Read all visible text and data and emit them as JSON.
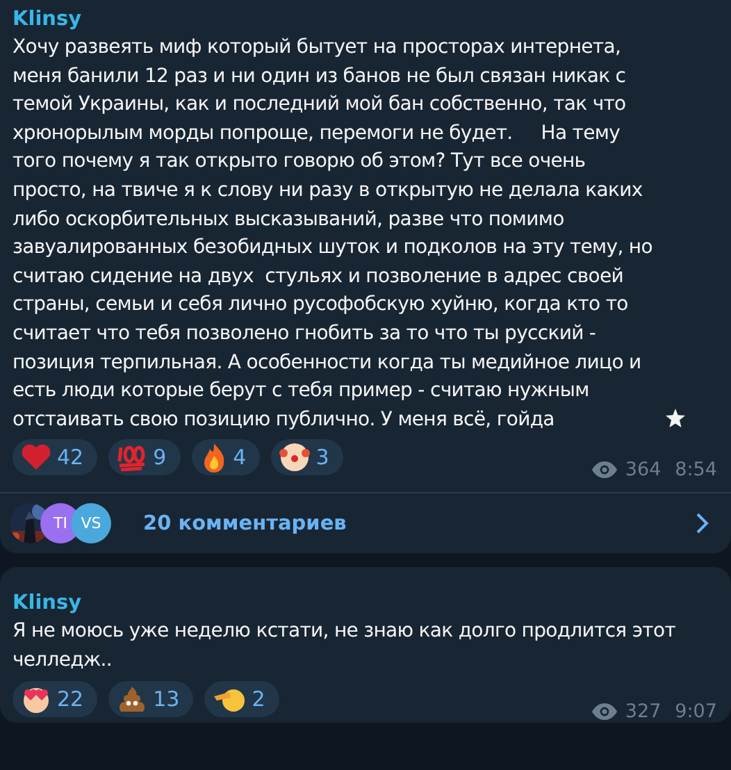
{
  "messages": [
    {
      "author": "Klinsy",
      "text": "Хочу развеять миф который бытует на просторах интернета,\nменя банили 12 раз и ни один из банов не был связан никак с\nтемой Украины, как и последний мой бан собственно, так что\nхрюнорылым морды попроще, перемоги не будет.     На тему\nтого почему я так открыто говорю об этом? Тут все очень\nпросто, на твиче я к слову ни разу в открытую не делала каких\nлибо оскорбительных высказываний, разве что помимо\nзавуалированных безобидных шуток и подколов на эту тему, но\nсчитаю сидение на двух  стульях и позволение в адрес своей\nстраны, семьи и себя лично русофобскую хуйню, когда кто то\nсчитает что тебя позволено гнобить за то что ты русский -\nпозиция терпильная. А особенности когда ты медийное лицо и\nесть люди которые берут с тебя пример - считаю нужным\nотстаивать свою позицию публично. У меня всё, гойда",
      "trailing_emoji": {
        "kind": "star"
      },
      "reactions": [
        {
          "kind": "heart",
          "count": "42"
        },
        {
          "kind": "hundred",
          "count": "9"
        },
        {
          "kind": "fire",
          "count": "4"
        },
        {
          "kind": "clown",
          "count": "3"
        }
      ],
      "views": "364",
      "time": "8:54",
      "comments": {
        "avatars": [
          {
            "kind": "picture"
          },
          {
            "kind": "initials",
            "initials": "TI",
            "color": "#9a6ff0"
          },
          {
            "kind": "initials",
            "initials": "VS",
            "color": "#4aa8dc"
          }
        ],
        "label": "20 комментариев"
      }
    },
    {
      "author": "Klinsy",
      "text": "Я не моюсь уже неделю кстати, не знаю как долго продлится этот\nчелледж..",
      "reactions": [
        {
          "kind": "hearteyes",
          "count": "22"
        },
        {
          "kind": "poo",
          "count": "13"
        },
        {
          "kind": "salute",
          "count": "2"
        }
      ],
      "views": "327",
      "time": "9:07"
    }
  ]
}
